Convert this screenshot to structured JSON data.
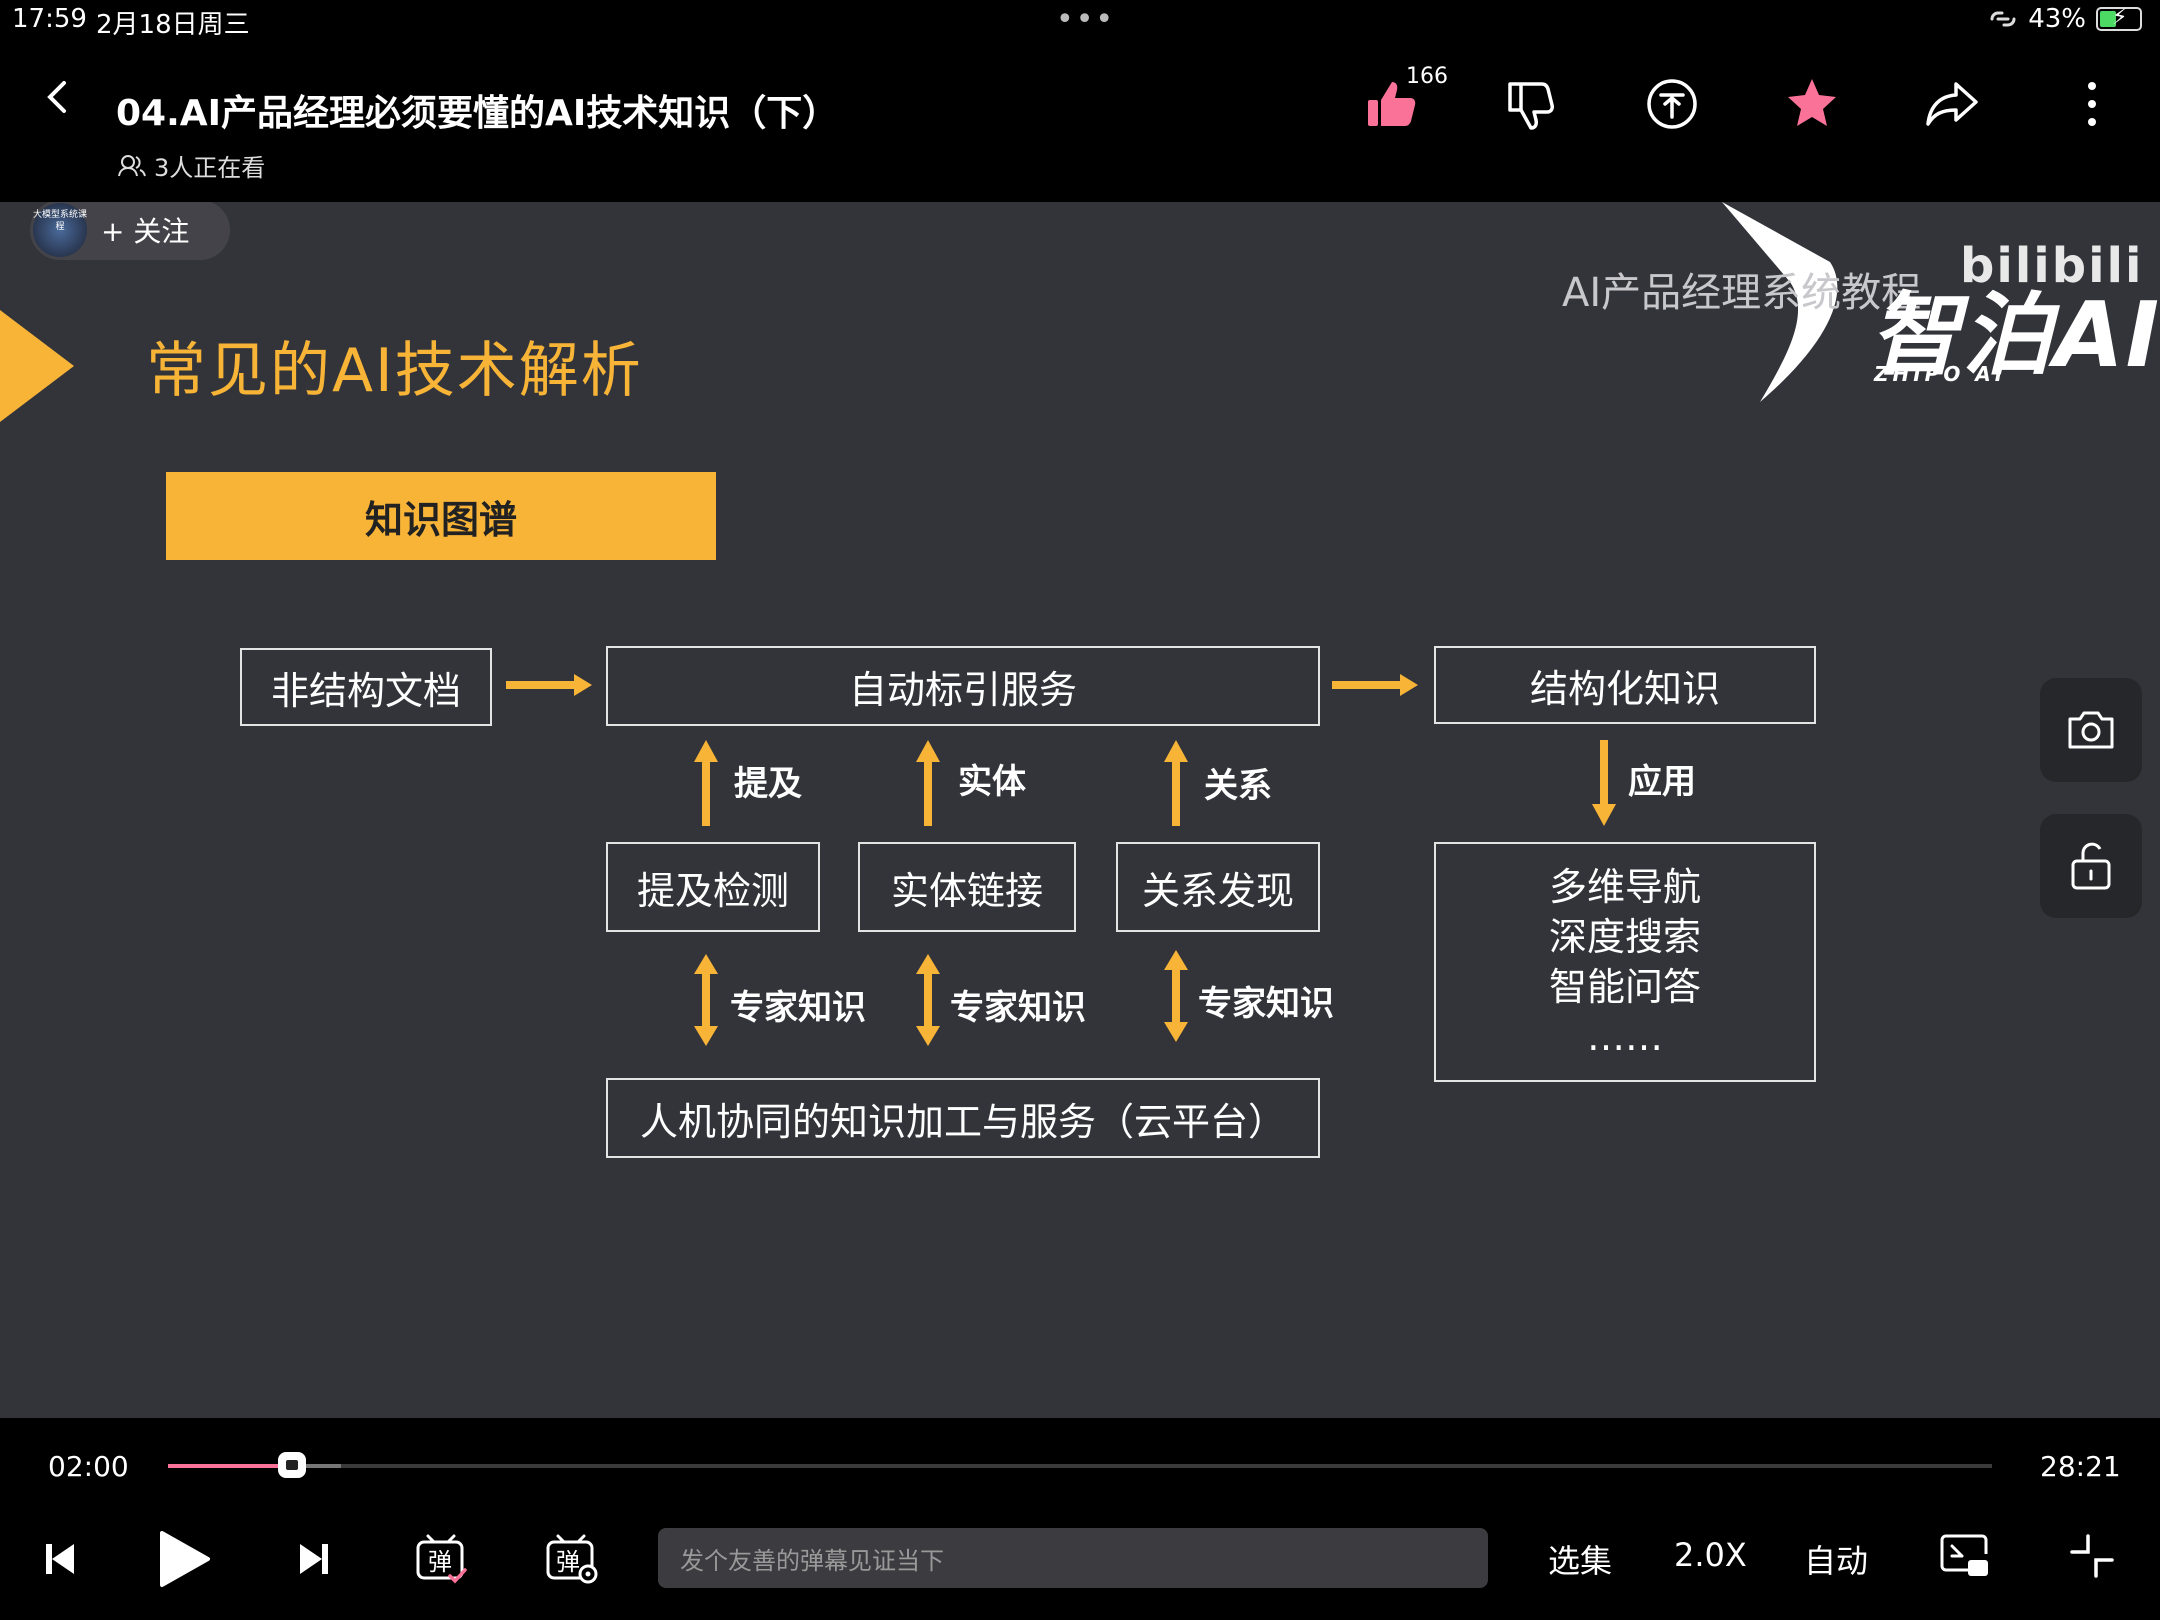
{
  "status": {
    "time": "17:59",
    "date": "2月18日周三",
    "battery": "43%"
  },
  "header": {
    "title": "04.AI产品经理必须要懂的AI技术知识（下）",
    "viewers": "3人正在看",
    "like_count": "166"
  },
  "uploader": {
    "avatar_text": "大模型系统课程",
    "follow_label": "+ 关注"
  },
  "slide": {
    "title": "常见的AI技术解析",
    "section": "知识图谱",
    "brand_sub": "AI产品经理系统教程",
    "brand_main": "智泊AI",
    "brand_en": "ZHIPO AI",
    "bili": "bilibili",
    "boxes": {
      "unstructured": "非结构文档",
      "auto_index": "自动标引服务",
      "structured": "结构化知识",
      "mention_detect": "提及检测",
      "entity_link": "实体链接",
      "relation_find": "关系发现",
      "cloud": "人机协同的知识加工与服务（云平台）",
      "app_lines": [
        "多维导航",
        "深度搜索",
        "智能问答",
        "……"
      ]
    },
    "labels": {
      "mention": "提及",
      "entity": "实体",
      "relation": "关系",
      "apply": "应用",
      "expert": "专家知识"
    }
  },
  "player": {
    "current": "02:00",
    "total": "28:21",
    "progress": 0.068,
    "buffered": 0.095,
    "danmaku_placeholder": "发个友善的弹幕见证当下",
    "episodes": "选集",
    "speed": "2.0X",
    "auto": "自动"
  },
  "colors": {
    "accent": "#f8b437",
    "progress": "#fb7299",
    "favorite": "#fb7299"
  }
}
